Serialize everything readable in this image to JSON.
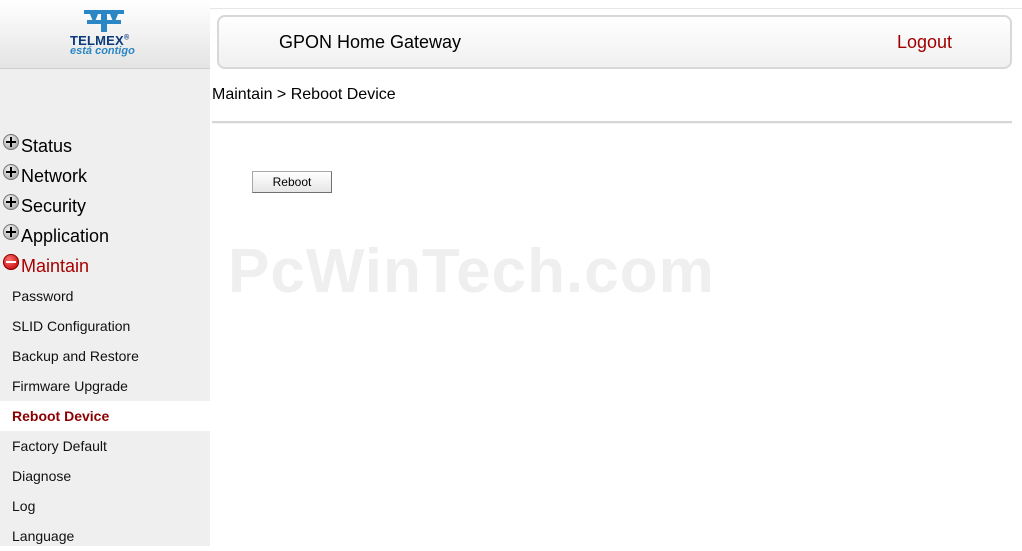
{
  "brand": {
    "name": "TELMEX",
    "tagline": "está contigo",
    "colors": {
      "primary": "#0a3a7d",
      "accent": "#2a86c4"
    }
  },
  "header": {
    "title": "GPON Home Gateway",
    "logout_label": "Logout",
    "logout_color": "#a00000"
  },
  "breadcrumb": "Maintain > Reboot Device",
  "sidebar": {
    "menus": [
      {
        "label": "Status",
        "state": "collapsed",
        "icon": "plus-icon"
      },
      {
        "label": "Network",
        "state": "collapsed",
        "icon": "plus-icon"
      },
      {
        "label": "Security",
        "state": "collapsed",
        "icon": "plus-icon"
      },
      {
        "label": "Application",
        "state": "collapsed",
        "icon": "plus-icon"
      },
      {
        "label": "Maintain",
        "state": "expanded",
        "icon": "minus-icon"
      }
    ],
    "submenu": [
      {
        "label": "Password"
      },
      {
        "label": "SLID Configuration"
      },
      {
        "label": "Backup and Restore"
      },
      {
        "label": "Firmware Upgrade"
      },
      {
        "label": "Reboot Device",
        "selected": true
      },
      {
        "label": "Factory Default"
      },
      {
        "label": "Diagnose"
      },
      {
        "label": "Log"
      },
      {
        "label": "Language"
      }
    ]
  },
  "main": {
    "reboot_button_label": "Reboot"
  },
  "watermark": "PcWinTech.com"
}
